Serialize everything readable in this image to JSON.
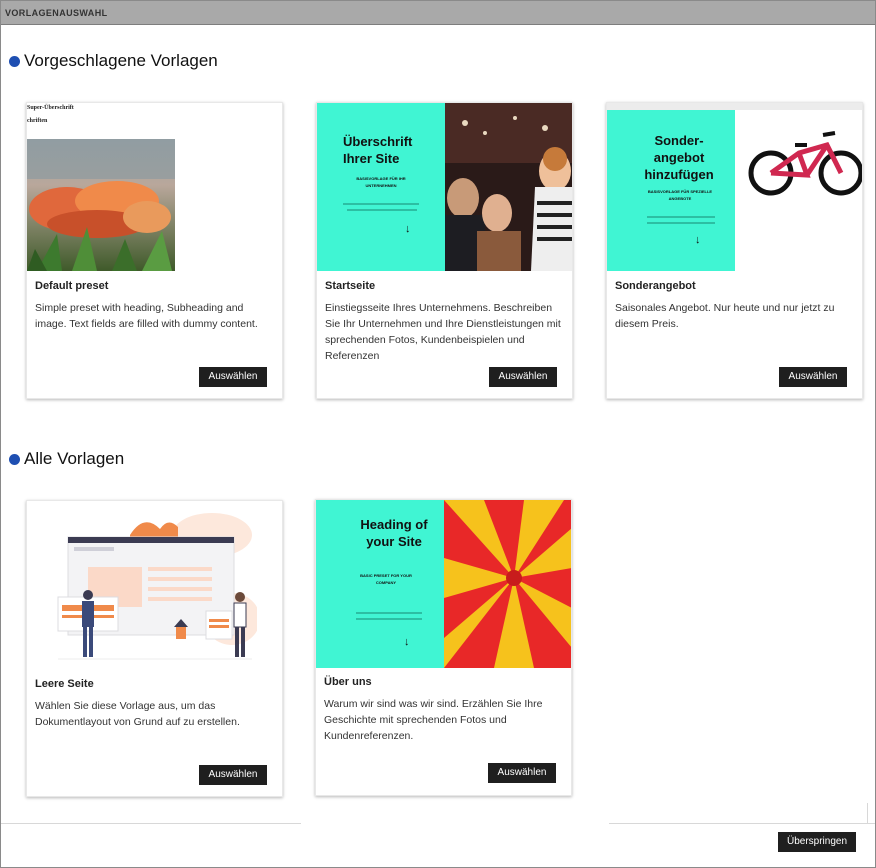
{
  "window": {
    "title": "VORLAGENAUSWAHL"
  },
  "sections": {
    "suggested": {
      "title": "Vorgeschlagene Vorlagen"
    },
    "all": {
      "title": "Alle Vorlagen"
    }
  },
  "suggested_cards": [
    {
      "title": "Default preset",
      "description": "Simple preset with heading, Subheading and image. Text fields are filled with dummy content.",
      "button": "Auswählen",
      "thumb": {
        "super_heading": "Super-Überschrift",
        "heading": "chriften"
      }
    },
    {
      "title": "Startseite",
      "description": "Einstiegsseite Ihres Unternehmens. Beschreiben Sie Ihr Unternehmen und Ihre Dienstleistungen mit sprechenden Fotos, Kundenbeispielen und Referenzen",
      "button": "Auswählen",
      "thumb": {
        "heading": "Überschrift Ihrer Site",
        "sub": "BASISVORLAGE FÜR IHR UNTERNEHMEN",
        "arrow": "↓"
      }
    },
    {
      "title": "Sonderangebot",
      "description": "Saisonales Angebot. Nur heute und nur jetzt zu diesem Preis.",
      "button": "Auswählen",
      "thumb": {
        "heading": "Sonder-angebot hinzufügen",
        "sub": "BASISVORLAGE FÜR SPEZIELLE ANGEBOTE",
        "arrow": "↓"
      }
    }
  ],
  "all_cards": [
    {
      "title": "Leere Seite",
      "description": "Wählen Sie diese Vorlage aus, um das Dokumentlayout von Grund auf zu erstellen.",
      "button": "Auswählen"
    },
    {
      "title": "Über uns",
      "description": "Warum wir sind was wir sind. Erzählen Sie Ihre Geschichte mit sprechenden Fotos und Kundenreferenzen.",
      "button": "Auswählen",
      "thumb": {
        "heading": "Heading of your Site",
        "sub": "BASIC PRESET FOR YOUR COMPANY",
        "arrow": "↓"
      }
    }
  ],
  "footer": {
    "skip_button": "Überspringen"
  },
  "colors": {
    "accent_dot": "#1e4fb2",
    "teal": "#40f5d3",
    "button_bg": "#1f1f1f"
  }
}
